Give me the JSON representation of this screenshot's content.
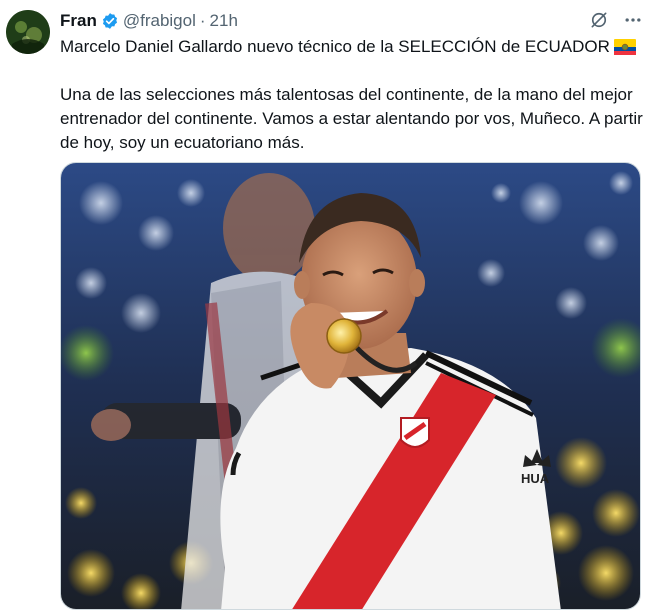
{
  "author": {
    "name": "Fran",
    "handle": "@frabigol",
    "separator": "·",
    "time": "21h"
  },
  "icons": {
    "verified": "verified-badge-icon",
    "grok": "grok-icon",
    "more": "more-icon",
    "flag": "ecuador-flag-icon"
  },
  "tweet": {
    "line1": "Marcelo Daniel Gallardo nuevo técnico de la SELECCIÓN de ECUADOR",
    "paragraph2": "Una de las selecciones más talentosas del continente, de la mano del mejor entrenador del continente. Vamos a estar alentando por vos, Muñeco. A partir de hoy, soy un ecuatoriano más."
  },
  "media": {
    "kind": "photo",
    "jersey_brand_text": "HUA"
  },
  "colors": {
    "verified": "#1d9bf0",
    "secondary_text": "#536471",
    "jersey_red": "#d7252b",
    "flag_yellow": "#ffd100",
    "flag_blue": "#034ea2",
    "flag_red": "#ef3340"
  }
}
